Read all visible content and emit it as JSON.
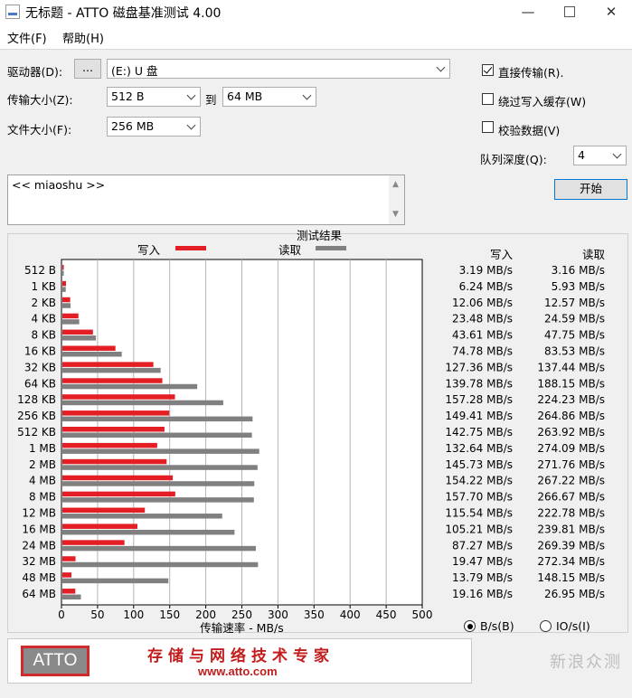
{
  "window": {
    "title": "无标题 - ATTO 磁盘基准测试 4.00"
  },
  "menu": [
    {
      "label": "文件(F)"
    },
    {
      "label": "帮助(H)"
    }
  ],
  "controls": {
    "drive_label": "驱动器(D):",
    "browse_label": "...",
    "drive_value": "(E:) U 盘",
    "transfer_label": "传输大小(Z):",
    "transfer_from": "512 B",
    "to_label": "到",
    "transfer_to": "64 MB",
    "file_size_label": "文件大小(F):",
    "file_size_value": "256 MB",
    "direct_io_label": "直接传输(R).",
    "direct_io_checked": true,
    "bypass_cache_label": "绕过写入缓存(W)",
    "bypass_cache_checked": false,
    "verify_label": "校验数据(V)",
    "verify_checked": false,
    "queue_label": "队列深度(Q):",
    "queue_value": "4",
    "start_label": "开始"
  },
  "notes_text": "<< miaoshu >>",
  "results": {
    "bps_label": "B/s(B)",
    "iops_label": "IO/s(I)",
    "bps_selected": true
  },
  "banner": {
    "logo_text": "ATTO",
    "slogan": "存储与网络技术专家",
    "url": "www.atto.com"
  },
  "watermark": "新浪众测",
  "chart_data": {
    "type": "bar",
    "orientation": "horizontal",
    "title": "测试结果",
    "xlabel": "传输速率 - MB/s",
    "xlim": [
      0,
      500
    ],
    "xticks": [
      0,
      50,
      100,
      150,
      200,
      250,
      300,
      350,
      400,
      450,
      500
    ],
    "grid": true,
    "legend_position": "top",
    "value_headers": [
      "写入",
      "读取"
    ],
    "categories": [
      "512 B",
      "1 KB",
      "2 KB",
      "4 KB",
      "8 KB",
      "16 KB",
      "32 KB",
      "64 KB",
      "128 KB",
      "256 KB",
      "512 KB",
      "1 MB",
      "2 MB",
      "4 MB",
      "8 MB",
      "12 MB",
      "16 MB",
      "24 MB",
      "32 MB",
      "48 MB",
      "64 MB"
    ],
    "series": [
      {
        "name": "写入",
        "color": "#e31e24",
        "values": [
          3.19,
          6.24,
          12.06,
          23.48,
          43.61,
          74.78,
          127.36,
          139.78,
          157.28,
          149.41,
          142.75,
          132.64,
          145.73,
          154.22,
          157.7,
          115.54,
          105.21,
          87.27,
          19.47,
          13.79,
          19.16
        ],
        "labels": [
          "3.19 MB/s",
          "6.24 MB/s",
          "12.06 MB/s",
          "23.48 MB/s",
          "43.61 MB/s",
          "74.78 MB/s",
          "127.36 MB/s",
          "139.78 MB/s",
          "157.28 MB/s",
          "149.41 MB/s",
          "142.75 MB/s",
          "132.64 MB/s",
          "145.73 MB/s",
          "154.22 MB/s",
          "157.70 MB/s",
          "115.54 MB/s",
          "105.21 MB/s",
          "87.27 MB/s",
          "19.47 MB/s",
          "13.79 MB/s",
          "19.16 MB/s"
        ]
      },
      {
        "name": "读取",
        "color": "#808080",
        "values": [
          3.16,
          5.93,
          12.57,
          24.59,
          47.75,
          83.53,
          137.44,
          188.15,
          224.23,
          264.86,
          263.92,
          274.09,
          271.76,
          267.22,
          266.67,
          222.78,
          239.81,
          269.39,
          272.34,
          148.15,
          26.95
        ],
        "labels": [
          "3.16 MB/s",
          "5.93 MB/s",
          "12.57 MB/s",
          "24.59 MB/s",
          "47.75 MB/s",
          "83.53 MB/s",
          "137.44 MB/s",
          "188.15 MB/s",
          "224.23 MB/s",
          "264.86 MB/s",
          "263.92 MB/s",
          "274.09 MB/s",
          "271.76 MB/s",
          "267.22 MB/s",
          "266.67 MB/s",
          "222.78 MB/s",
          "239.81 MB/s",
          "269.39 MB/s",
          "272.34 MB/s",
          "148.15 MB/s",
          "26.95 MB/s"
        ]
      }
    ]
  }
}
